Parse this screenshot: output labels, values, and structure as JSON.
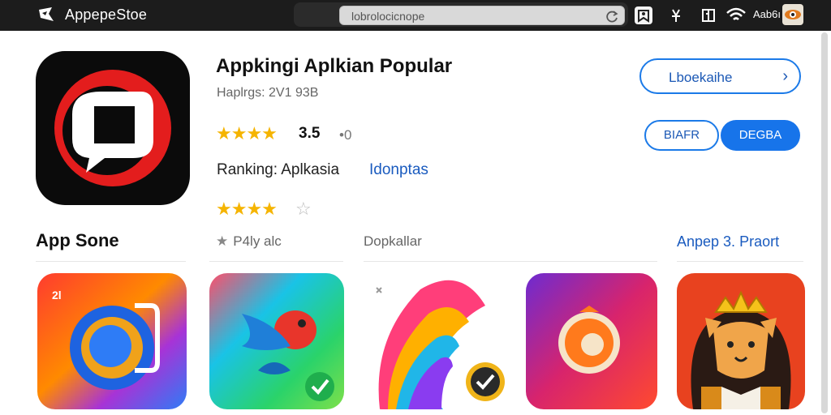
{
  "browser": {
    "title": "AppepeStoe",
    "address": "lobrolocicnope",
    "status": "Aab6ı"
  },
  "app": {
    "name": "Appkingi Aplkian Popular",
    "size": "Haplrgs: 2V1 93B",
    "rating_stars": "★★★★",
    "rating_value": "3.5",
    "rating_suffix": "•0",
    "ranking_label": "Ranking: Aplkasia",
    "ranking_value": "Idonptas",
    "secondary_stars": "★★★★",
    "secondary_stars_tail": "☆",
    "primary_button": "Lboekaihe",
    "button_outline": "BIAFR",
    "button_filled": "DEGBA"
  },
  "section": {
    "title": "App Sone",
    "rating_text": "P4ly alc",
    "category_text": "Dopkallar",
    "link_text": "Anpep 3. Praort"
  },
  "tiles": [
    {
      "name": "tile-chat-app",
      "badge": "2l"
    },
    {
      "name": "tile-bird-app"
    },
    {
      "name": "tile-feather-app"
    },
    {
      "name": "tile-ring-app"
    },
    {
      "name": "tile-lion-app"
    }
  ],
  "colors": {
    "accent": "#1774ea",
    "star": "#f5b400",
    "link": "#1a5bbf",
    "topbar": "#1c1c1c"
  }
}
